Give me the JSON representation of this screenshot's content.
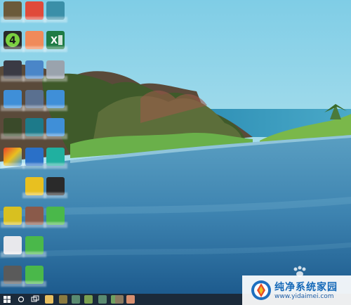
{
  "desktop": {
    "icons": [
      {
        "name": "app-icon-1",
        "color": "#6b5a3a"
      },
      {
        "name": "app-icon-2",
        "color": "#e04a3a"
      },
      {
        "name": "app-icon-3",
        "color": "#3a8fa8"
      },
      {
        "name": "app-icon-4",
        "color": "#2a2a2a",
        "badge": "4"
      },
      {
        "name": "app-icon-5",
        "color": "#f08a5a"
      },
      {
        "name": "excel-icon",
        "color": "#1e7b45",
        "badge": "X"
      },
      {
        "name": "app-icon-7",
        "color": "#3a3a44"
      },
      {
        "name": "app-icon-8",
        "color": "#4a86c8"
      },
      {
        "name": "app-icon-9",
        "color": "#9aa3ad"
      },
      {
        "name": "app-icon-10",
        "color": "#3f8fd8"
      },
      {
        "name": "app-icon-11",
        "color": "#5a7090"
      },
      {
        "name": "app-icon-12",
        "color": "#3f8fd8"
      },
      {
        "name": "app-icon-13",
        "color": "#3a4a2a"
      },
      {
        "name": "app-icon-14",
        "color": "#1d7a8a"
      },
      {
        "name": "app-icon-15",
        "color": "#3f8fd8"
      },
      {
        "name": "app-icon-16",
        "color": "#e0a020"
      },
      {
        "name": "app-icon-17",
        "color": "#2a70c8"
      },
      {
        "name": "app-icon-18",
        "color": "#20b0a0"
      },
      {
        "name": "app-icon-19",
        "color": "#e8c020"
      },
      {
        "name": "app-icon-20",
        "color": "#2a2a2a"
      },
      {
        "name": "app-icon-21",
        "color": "#d8c020"
      },
      {
        "name": "app-icon-22",
        "color": "#8a5a4a"
      },
      {
        "name": "app-icon-23",
        "color": "#4ab84a"
      },
      {
        "name": "app-icon-24",
        "color": "#e8e8ec"
      },
      {
        "name": "app-icon-25",
        "color": "#4ab84a"
      },
      {
        "name": "app-icon-26",
        "color": "#5a5a5a"
      },
      {
        "name": "app-icon-27",
        "color": "#4ab84a"
      }
    ]
  },
  "taskbar": {
    "items": [
      {
        "name": "start-button-icon",
        "color": "#ffffff"
      },
      {
        "name": "search-icon",
        "color": "#ffffff"
      },
      {
        "name": "task-view-icon",
        "color": "#ffffff"
      },
      {
        "name": "file-explorer-icon",
        "color": "#e8c060"
      },
      {
        "name": "taskbar-app-1",
        "color": "#8a7a40"
      },
      {
        "name": "taskbar-app-2",
        "color": "#5a8a70"
      },
      {
        "name": "taskbar-app-3",
        "color": "#7aa050"
      },
      {
        "name": "taskbar-app-4",
        "color": "#5a8a70"
      },
      {
        "name": "taskbar-app-5",
        "color": "#70a060"
      },
      {
        "name": "taskbar-app-6",
        "color": "#8a7a60"
      },
      {
        "name": "taskbar-app-7",
        "color": "#d89070"
      }
    ]
  },
  "watermark": {
    "title": "纯净系统家园",
    "url": "www.yidaimei.com"
  }
}
